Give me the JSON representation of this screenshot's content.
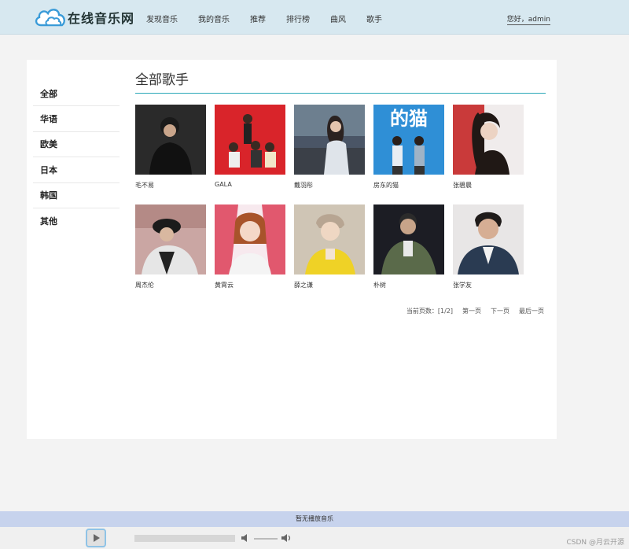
{
  "header": {
    "logo_text": "在线音乐网",
    "nav": [
      "发现音乐",
      "我的音乐",
      "推荐",
      "排行榜",
      "曲风",
      "歌手"
    ],
    "greeting": "您好，admin"
  },
  "sidebar": {
    "items": [
      "全部",
      "华语",
      "欧美",
      "日本",
      "韩国",
      "其他"
    ]
  },
  "main": {
    "title": "全部歌手",
    "artists": [
      {
        "name": "毛不易"
      },
      {
        "name": "GALA"
      },
      {
        "name": "戴羽彤"
      },
      {
        "name": "房东的猫"
      },
      {
        "name": "张碧晨"
      },
      {
        "name": "周杰伦"
      },
      {
        "name": "黄霄云"
      },
      {
        "name": "薛之谦"
      },
      {
        "name": "朴树"
      },
      {
        "name": "张学友"
      }
    ],
    "thumb_text_4": "的猫"
  },
  "pager": {
    "info": "当前页数：[1/2]",
    "first": "第一页",
    "next": "下一页",
    "last": "最后一页"
  },
  "player": {
    "status": "暂无播放音乐"
  },
  "watermark": "CSDN @月云开源"
}
